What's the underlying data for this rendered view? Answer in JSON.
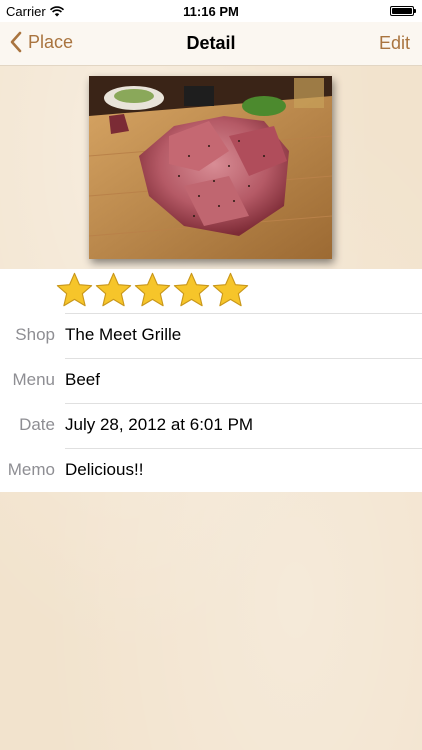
{
  "status_bar": {
    "carrier": "Carrier",
    "time": "11:16 PM",
    "icons": [
      "wifi-icon",
      "battery-icon"
    ]
  },
  "nav": {
    "back_label": "Place",
    "title": "Detail",
    "edit_label": "Edit",
    "accent_color": "#a9743f"
  },
  "photo": {
    "icon": "meat-photo"
  },
  "rating": {
    "stars": 5,
    "max": 5,
    "star_color": "#f6c52a"
  },
  "fields": [
    {
      "label": "Shop",
      "value": "The Meet Grille"
    },
    {
      "label": "Menu",
      "value": "Beef"
    },
    {
      "label": "Date",
      "value": "July 28, 2012 at 6:01 PM"
    },
    {
      "label": "Memo",
      "value": "Delicious!!"
    }
  ]
}
